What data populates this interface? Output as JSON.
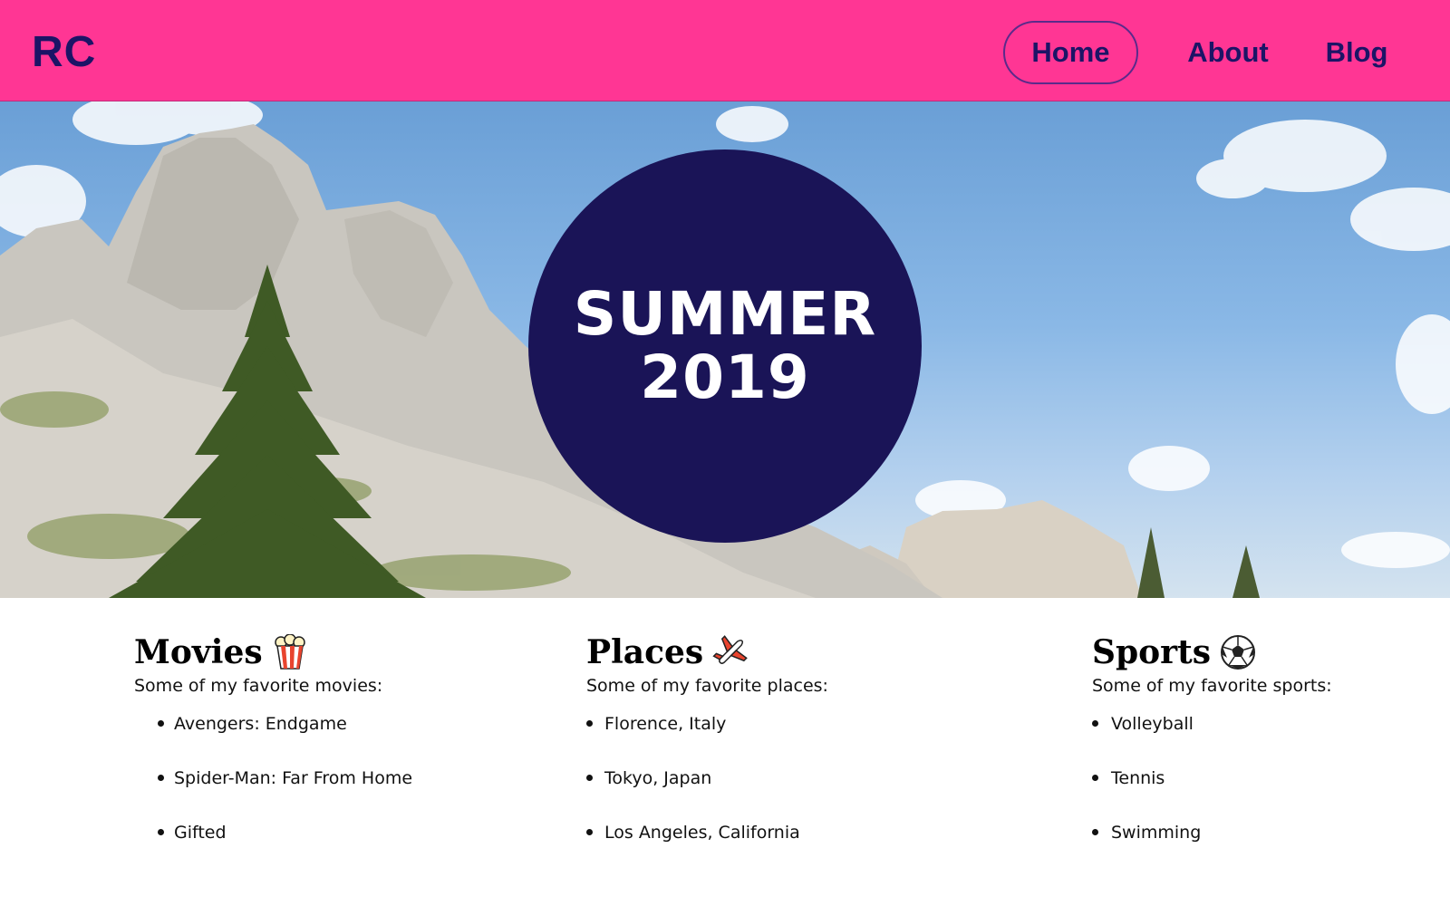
{
  "header": {
    "logo": "RC",
    "nav": [
      {
        "label": "Home",
        "active": true
      },
      {
        "label": "About",
        "active": false
      },
      {
        "label": "Blog",
        "active": false
      }
    ]
  },
  "hero": {
    "line1": "SUMMER",
    "line2": "2019"
  },
  "sections": [
    {
      "title": "Movies",
      "icon": "popcorn-icon",
      "subtitle": "Some of my favorite movies:",
      "items": [
        "Avengers: Endgame",
        "Spider-Man: Far From Home",
        "Gifted"
      ]
    },
    {
      "title": "Places",
      "icon": "airplane-icon",
      "subtitle": "Some of my favorite places:",
      "items": [
        "Florence, Italy",
        "Tokyo, Japan",
        "Los Angeles, California"
      ]
    },
    {
      "title": "Sports",
      "icon": "soccer-ball-icon",
      "subtitle": "Some of my favorite sports:",
      "items": [
        "Volleyball",
        "Tennis",
        "Swimming"
      ]
    }
  ],
  "colors": {
    "navbar": "#ff3694",
    "navText": "#1c1466",
    "circle": "#1a1457"
  }
}
